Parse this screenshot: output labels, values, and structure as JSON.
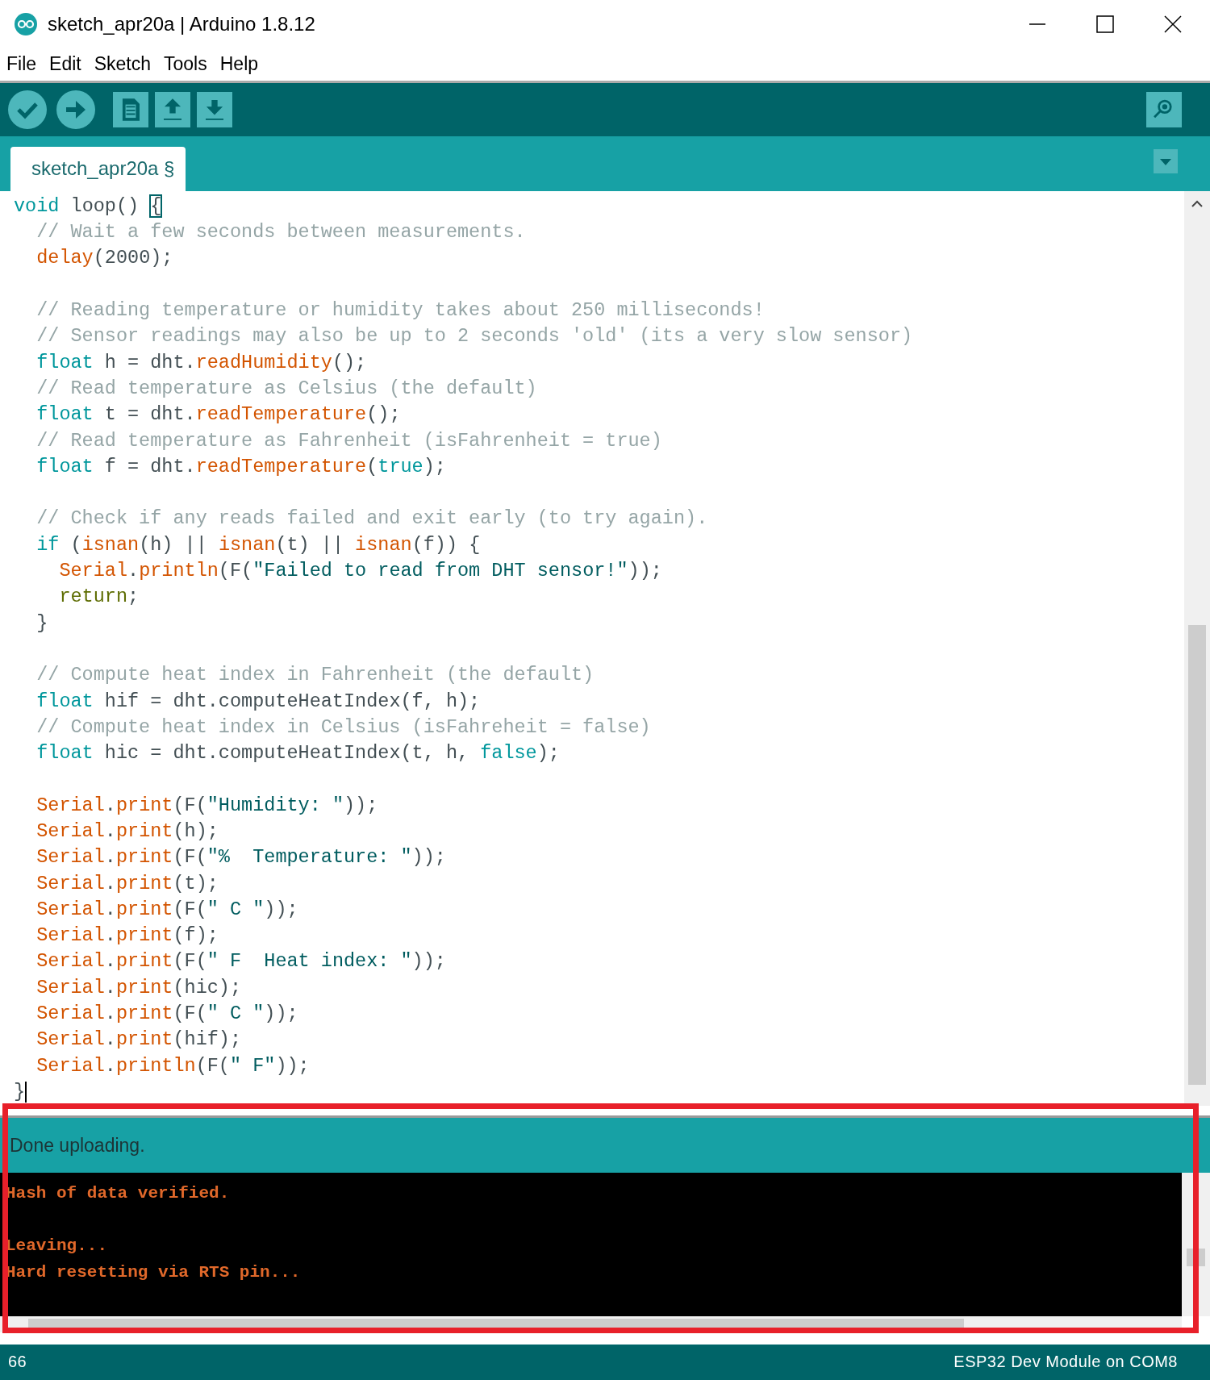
{
  "window": {
    "title": "sketch_apr20a | Arduino 1.8.12"
  },
  "menu": [
    "File",
    "Edit",
    "Sketch",
    "Tools",
    "Help"
  ],
  "toolbar": [
    {
      "kind": "verify"
    },
    {
      "kind": "upload"
    },
    {
      "kind": "new"
    },
    {
      "kind": "open"
    },
    {
      "kind": "save"
    },
    {
      "kind": "serial_monitor"
    }
  ],
  "tabs": [
    {
      "label": "sketch_apr20a §",
      "selected": true
    }
  ],
  "editor": {
    "lines": [
      {
        "tokens": [
          {
            "kind": "keyword",
            "text": "void"
          },
          {
            "kind": "plain",
            "text": " loop() "
          },
          {
            "kind": "brace_match",
            "text": "{"
          }
        ],
        "children": [
          {
            "tokens": [
              {
                "kind": "comment",
                "text": "// Wait a few seconds between measurements."
              }
            ]
          },
          {
            "tokens": [
              {
                "kind": "func",
                "text": "delay"
              },
              {
                "kind": "plain",
                "text": "(2000);"
              }
            ]
          },
          {
            "gap_before": true,
            "tokens": [
              {
                "kind": "comment",
                "text": "// Reading temperature or humidity takes about 250 milliseconds!"
              }
            ]
          },
          {
            "tokens": [
              {
                "kind": "comment",
                "text": "// Sensor readings may also be up to 2 seconds 'old' (its a very slow sensor)"
              }
            ]
          },
          {
            "tokens": [
              {
                "kind": "keyword",
                "text": "float"
              },
              {
                "kind": "plain",
                "text": " h = dht."
              },
              {
                "kind": "func",
                "text": "readHumidity"
              },
              {
                "kind": "plain",
                "text": "();"
              }
            ]
          },
          {
            "tokens": [
              {
                "kind": "comment",
                "text": "// Read temperature as Celsius (the default)"
              }
            ]
          },
          {
            "tokens": [
              {
                "kind": "keyword",
                "text": "float"
              },
              {
                "kind": "plain",
                "text": " t = dht."
              },
              {
                "kind": "func",
                "text": "readTemperature"
              },
              {
                "kind": "plain",
                "text": "();"
              }
            ]
          },
          {
            "tokens": [
              {
                "kind": "comment",
                "text": "// Read temperature as Fahrenheit (isFahrenheit = true)"
              }
            ]
          },
          {
            "tokens": [
              {
                "kind": "keyword",
                "text": "float"
              },
              {
                "kind": "plain",
                "text": " f = dht."
              },
              {
                "kind": "func",
                "text": "readTemperature"
              },
              {
                "kind": "plain",
                "text": "("
              },
              {
                "kind": "keyword",
                "text": "true"
              },
              {
                "kind": "plain",
                "text": ");"
              }
            ]
          },
          {
            "gap_before": true,
            "tokens": [
              {
                "kind": "comment",
                "text": "// Check if any reads failed and exit early (to try again)."
              }
            ]
          },
          {
            "tokens": [
              {
                "kind": "keyword",
                "text": "if"
              },
              {
                "kind": "plain",
                "text": " ("
              },
              {
                "kind": "func",
                "text": "isnan"
              },
              {
                "kind": "plain",
                "text": "(h) || "
              },
              {
                "kind": "func",
                "text": "isnan"
              },
              {
                "kind": "plain",
                "text": "(t) || "
              },
              {
                "kind": "func",
                "text": "isnan"
              },
              {
                "kind": "plain",
                "text": "(f)) {"
              }
            ],
            "children": [
              {
                "tokens": [
                  {
                    "kind": "func",
                    "text": "Serial"
                  },
                  {
                    "kind": "plain",
                    "text": "."
                  },
                  {
                    "kind": "func",
                    "text": "println"
                  },
                  {
                    "kind": "plain",
                    "text": "(F("
                  },
                  {
                    "kind": "string",
                    "text": "\"Failed to read from DHT sensor!\""
                  },
                  {
                    "kind": "plain",
                    "text": "));"
                  }
                ]
              },
              {
                "tokens": [
                  {
                    "kind": "control",
                    "text": "return"
                  },
                  {
                    "kind": "plain",
                    "text": ";"
                  }
                ]
              }
            ]
          },
          {
            "tokens": [
              {
                "kind": "plain",
                "text": "}"
              }
            ]
          },
          {
            "gap_before": true,
            "tokens": [
              {
                "kind": "comment",
                "text": "// Compute heat index in Fahrenheit (the default)"
              }
            ]
          },
          {
            "tokens": [
              {
                "kind": "keyword",
                "text": "float"
              },
              {
                "kind": "plain",
                "text": " hif = dht.computeHeatIndex(f, h);"
              }
            ]
          },
          {
            "tokens": [
              {
                "kind": "comment",
                "text": "// Compute heat index in Celsius (isFahreheit = false)"
              }
            ]
          },
          {
            "tokens": [
              {
                "kind": "keyword",
                "text": "float"
              },
              {
                "kind": "plain",
                "text": " hic = dht.computeHeatIndex(t, h, "
              },
              {
                "kind": "keyword",
                "text": "false"
              },
              {
                "kind": "plain",
                "text": ");"
              }
            ]
          },
          {
            "gap_before": true,
            "tokens": [
              {
                "kind": "func",
                "text": "Serial"
              },
              {
                "kind": "plain",
                "text": "."
              },
              {
                "kind": "func",
                "text": "print"
              },
              {
                "kind": "plain",
                "text": "(F("
              },
              {
                "kind": "string",
                "text": "\"Humidity: \""
              },
              {
                "kind": "plain",
                "text": "));"
              }
            ]
          },
          {
            "tokens": [
              {
                "kind": "func",
                "text": "Serial"
              },
              {
                "kind": "plain",
                "text": "."
              },
              {
                "kind": "func",
                "text": "print"
              },
              {
                "kind": "plain",
                "text": "(h);"
              }
            ]
          },
          {
            "tokens": [
              {
                "kind": "func",
                "text": "Serial"
              },
              {
                "kind": "plain",
                "text": "."
              },
              {
                "kind": "func",
                "text": "print"
              },
              {
                "kind": "plain",
                "text": "(F("
              },
              {
                "kind": "string",
                "text": "\"%  Temperature: \""
              },
              {
                "kind": "plain",
                "text": "));"
              }
            ]
          },
          {
            "tokens": [
              {
                "kind": "func",
                "text": "Serial"
              },
              {
                "kind": "plain",
                "text": "."
              },
              {
                "kind": "func",
                "text": "print"
              },
              {
                "kind": "plain",
                "text": "(t);"
              }
            ]
          },
          {
            "tokens": [
              {
                "kind": "func",
                "text": "Serial"
              },
              {
                "kind": "plain",
                "text": "."
              },
              {
                "kind": "func",
                "text": "print"
              },
              {
                "kind": "plain",
                "text": "(F("
              },
              {
                "kind": "string",
                "text": "\" C \""
              },
              {
                "kind": "plain",
                "text": "));"
              }
            ]
          },
          {
            "tokens": [
              {
                "kind": "func",
                "text": "Serial"
              },
              {
                "kind": "plain",
                "text": "."
              },
              {
                "kind": "func",
                "text": "print"
              },
              {
                "kind": "plain",
                "text": "(f);"
              }
            ]
          },
          {
            "tokens": [
              {
                "kind": "func",
                "text": "Serial"
              },
              {
                "kind": "plain",
                "text": "."
              },
              {
                "kind": "func",
                "text": "print"
              },
              {
                "kind": "plain",
                "text": "(F("
              },
              {
                "kind": "string",
                "text": "\" F  Heat index: \""
              },
              {
                "kind": "plain",
                "text": "));"
              }
            ]
          },
          {
            "tokens": [
              {
                "kind": "func",
                "text": "Serial"
              },
              {
                "kind": "plain",
                "text": "."
              },
              {
                "kind": "func",
                "text": "print"
              },
              {
                "kind": "plain",
                "text": "(hic);"
              }
            ]
          },
          {
            "tokens": [
              {
                "kind": "func",
                "text": "Serial"
              },
              {
                "kind": "plain",
                "text": "."
              },
              {
                "kind": "func",
                "text": "print"
              },
              {
                "kind": "plain",
                "text": "(F("
              },
              {
                "kind": "string",
                "text": "\" C \""
              },
              {
                "kind": "plain",
                "text": "));"
              }
            ]
          },
          {
            "tokens": [
              {
                "kind": "func",
                "text": "Serial"
              },
              {
                "kind": "plain",
                "text": "."
              },
              {
                "kind": "func",
                "text": "print"
              },
              {
                "kind": "plain",
                "text": "(hif);"
              }
            ]
          },
          {
            "tokens": [
              {
                "kind": "func",
                "text": "Serial"
              },
              {
                "kind": "plain",
                "text": "."
              },
              {
                "kind": "func",
                "text": "println"
              },
              {
                "kind": "plain",
                "text": "(F("
              },
              {
                "kind": "string",
                "text": "\" F\""
              },
              {
                "kind": "plain",
                "text": "));"
              }
            ]
          }
        ]
      },
      {
        "tokens": [
          {
            "kind": "plain",
            "text": "}"
          }
        ],
        "cursor": true
      }
    ]
  },
  "message": "Done uploading.",
  "console": {
    "lines": [
      {
        "text": "Hash of data verified."
      },
      {
        "gap_before": true,
        "text": "Leaving..."
      },
      {
        "text": "Hard resetting via RTS pin..."
      }
    ]
  },
  "status_bar": {
    "line_number": "66",
    "board": "ESP32 Dev Module on COM8"
  }
}
